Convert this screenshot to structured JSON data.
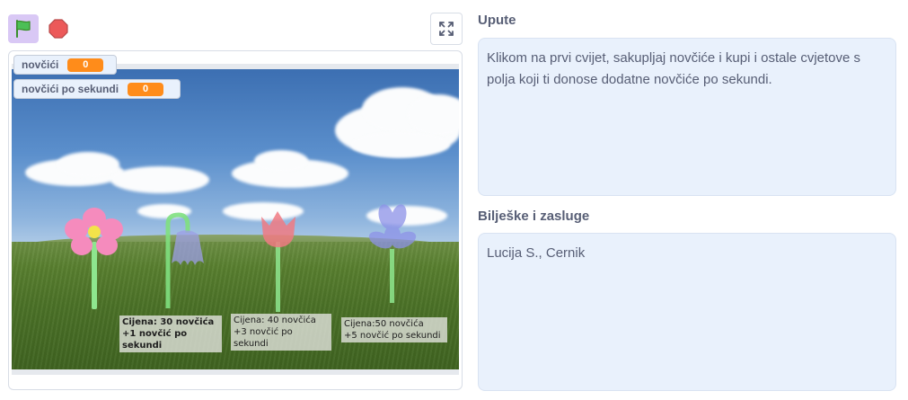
{
  "toolbar": {
    "green_flag_icon": "green-flag-icon",
    "stop_icon": "stop-icon",
    "fullscreen_icon": "fullscreen-icon"
  },
  "monitors": [
    {
      "label": "novčići",
      "value": "0"
    },
    {
      "label": "novčići po sekundi",
      "value": "0"
    }
  ],
  "prices": [
    {
      "line1": "Cijena: 30 novčića",
      "line2": "+1 novčić po sekundi"
    },
    {
      "line1": "Cijena: 40 novčića",
      "line2": "+3 novčić po sekundi"
    },
    {
      "line1": "Cijena:50 novčića",
      "line2": "+5 novčić po sekundi"
    }
  ],
  "instructions": {
    "title": "Upute",
    "text": "Klikom na prvi cvijet, sakupljaj novčiće i kupi i ostale cvjetove s polja koji ti donose dodatne novčiće po sekundi."
  },
  "credits": {
    "title": "Bilješke i zasluge",
    "text": "Lucija S., Cernik"
  },
  "colors": {
    "monitor_value": "#ff8c1a",
    "flag_active_bg": "#d9c8f5",
    "text": "#575e75",
    "panel_bg": "#e9f1fc"
  }
}
